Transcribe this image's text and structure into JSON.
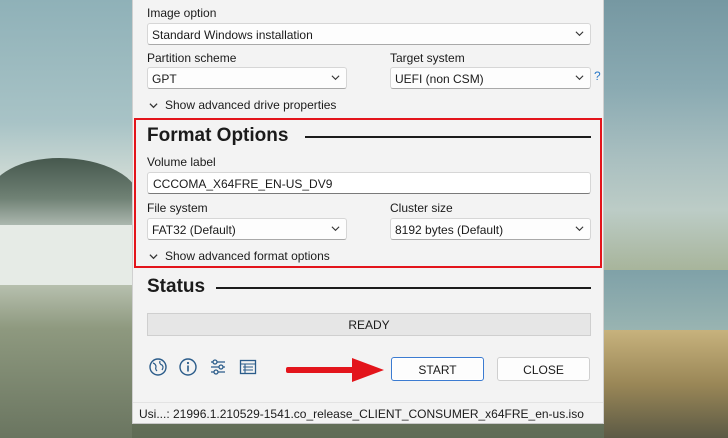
{
  "image_option": {
    "label": "Image option",
    "value": "Standard Windows installation"
  },
  "partition_scheme": {
    "label": "Partition scheme",
    "value": "GPT"
  },
  "target_system": {
    "label": "Target system",
    "value": "UEFI (non CSM)",
    "help": "?"
  },
  "advanced_drive": {
    "label": "Show advanced drive properties"
  },
  "format_options": {
    "title": "Format Options",
    "volume_label": {
      "label": "Volume label",
      "value": "CCCOMA_X64FRE_EN-US_DV9"
    },
    "file_system": {
      "label": "File system",
      "value": "FAT32 (Default)"
    },
    "cluster_size": {
      "label": "Cluster size",
      "value": "8192 bytes (Default)"
    },
    "advanced_format": {
      "label": "Show advanced format options"
    }
  },
  "status": {
    "title": "Status",
    "text": "READY"
  },
  "toolbar": {
    "icons": [
      "globe-icon",
      "info-icon",
      "settings-sliders-icon",
      "log-icon"
    ]
  },
  "buttons": {
    "start": "START",
    "close": "CLOSE"
  },
  "footer": {
    "text": "Usi...: 21996.1.210529-1541.co_release_CLIENT_CONSUMER_x64FRE_en-us.iso"
  },
  "colors": {
    "highlight_box": "#e3141b",
    "arrow": "#e3141b",
    "link": "#2a79c8"
  }
}
